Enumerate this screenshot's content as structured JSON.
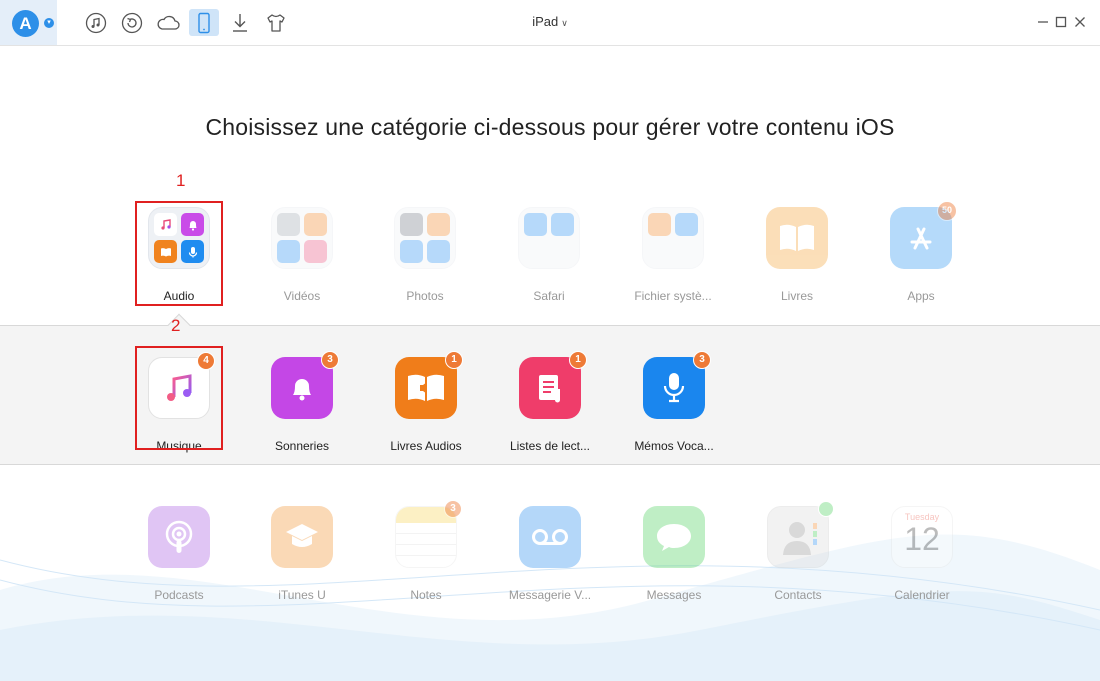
{
  "toolbar": {
    "logo_letter": "A",
    "device_name": "iPad",
    "buttons": [
      "itunes-library",
      "backup-restore",
      "icloud",
      "device",
      "download",
      "toolkit"
    ]
  },
  "heading": "Choisissez une catégorie ci-dessous pour gérer votre contenu iOS",
  "categories": [
    {
      "label": "Audio"
    },
    {
      "label": "Vidéos"
    },
    {
      "label": "Photos"
    },
    {
      "label": "Safari"
    },
    {
      "label": "Fichier systè..."
    },
    {
      "label": "Livres"
    },
    {
      "label": "Apps",
      "badge": "50"
    }
  ],
  "audio_items": [
    {
      "label": "Musique",
      "badge": "4"
    },
    {
      "label": "Sonneries",
      "badge": "3"
    },
    {
      "label": "Livres Audios",
      "badge": "1"
    },
    {
      "label": "Listes de lect...",
      "badge": "1"
    },
    {
      "label": "Mémos Voca...",
      "badge": "3"
    }
  ],
  "other_categories": [
    {
      "label": "Podcasts"
    },
    {
      "label": "iTunes U"
    },
    {
      "label": "Notes",
      "badge": "3"
    },
    {
      "label": "Messagerie V..."
    },
    {
      "label": "Messages"
    },
    {
      "label": "Contacts"
    },
    {
      "label": "Calendrier",
      "day_name": "Tuesday",
      "day_number": "12"
    }
  ],
  "annotations": {
    "step1": "1",
    "step2": "2"
  },
  "colors": {
    "accent": "#2d8fe8",
    "badge": "#ee7a36",
    "highlight": "#e02020"
  }
}
